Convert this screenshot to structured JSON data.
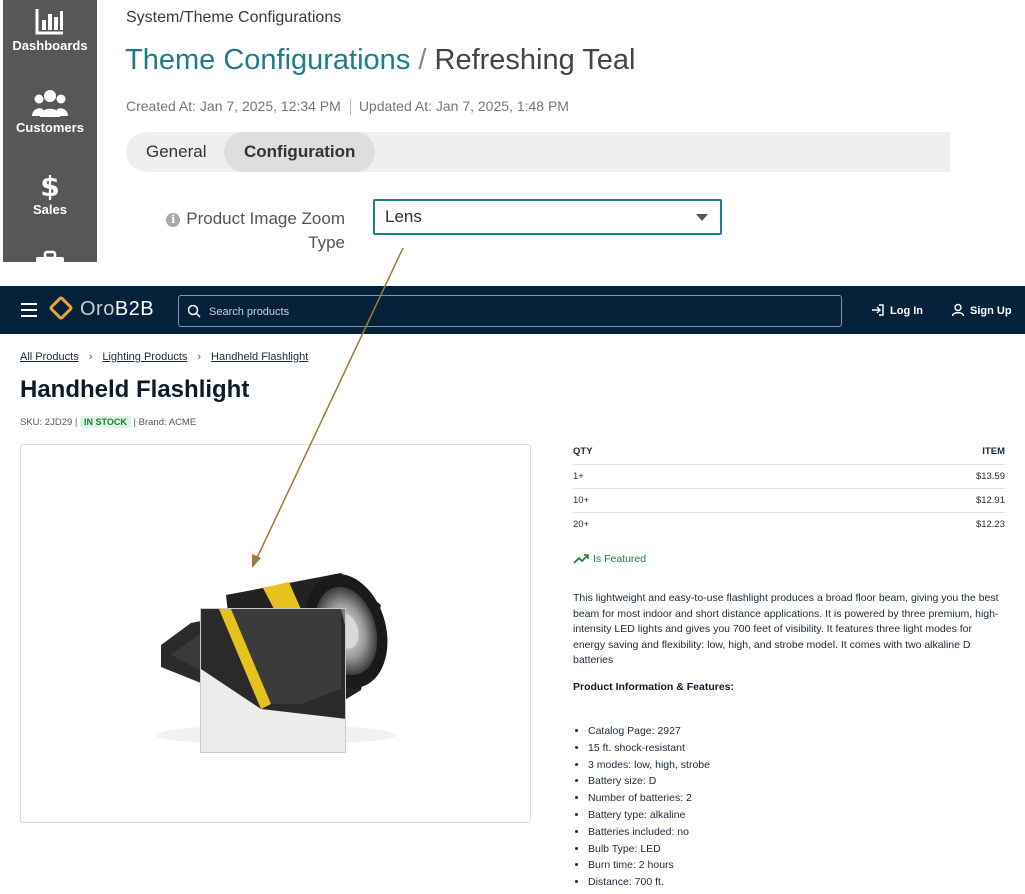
{
  "sidebar": {
    "items": [
      {
        "label": "Dashboards",
        "icon": "chart-bar-icon"
      },
      {
        "label": "Customers",
        "icon": "users-icon"
      },
      {
        "label": "Sales",
        "icon": "dollar-icon"
      },
      {
        "label": "",
        "icon": "briefcase-icon"
      }
    ]
  },
  "admin": {
    "breadcrumb": {
      "part1": "System",
      "sep": "/",
      "part2": "Theme Configurations"
    },
    "title": {
      "section": "Theme Configurations",
      "sep": "/",
      "name": "Refreshing Teal"
    },
    "created": "Created At: Jan 7, 2025, 12:34 PM",
    "updated": "Updated At: Jan 7, 2025, 1:48 PM",
    "tabs": [
      {
        "label": "General",
        "active": false
      },
      {
        "label": "Configuration",
        "active": true
      }
    ],
    "field": {
      "label": "Product Image Zoom Type",
      "value": "Lens",
      "info_icon": "i"
    },
    "accent": "#1d7d8a"
  },
  "store": {
    "logo_text_a": "Oro",
    "logo_text_b": "B2B",
    "search_placeholder": "Search products",
    "login_label": "Log In",
    "signup_label": "Sign Up",
    "breadcrumbs": [
      "All Products",
      "Lighting Products",
      "Handheld Flashlight"
    ],
    "product_title": "Handheld Flashlight",
    "sku": "SKU: 2JD29",
    "stock": "IN STOCK",
    "brand": "Brand: ACME",
    "price_table": {
      "headers": [
        "QTY",
        "ITEM"
      ],
      "rows": [
        {
          "qty": "1+",
          "price": "$13.59"
        },
        {
          "qty": "10+",
          "price": "$12.91"
        },
        {
          "qty": "20+",
          "price": "$12.23"
        }
      ]
    },
    "featured_label": "Is Featured",
    "description": "This lightweight and easy-to-use flashlight produces a broad floor beam, giving you the best beam for most indoor and short distance applications. It is powered by three premium, high-intensity LED lights and gives you 700 feet of visibility. It features three light modes for energy saving and flexibility: low, high, and strobe model. It comes with two alkaline D batteries",
    "features_heading": "Product Information & Features:",
    "features": [
      "Catalog Page: 2927",
      "15 ft. shock-resistant",
      "3 modes: low, high, strobe",
      "Battery size: D",
      "Number of batteries: 2",
      "Battery type: alkaline",
      "Batteries included: no",
      "Bulb Type: LED",
      "Burn time: 2 hours",
      "Distance: 700 ft."
    ],
    "colors": {
      "header_bg": "#05223a",
      "in_stock": "#1a7f3a",
      "logo_accent": "#e8a33c"
    }
  }
}
